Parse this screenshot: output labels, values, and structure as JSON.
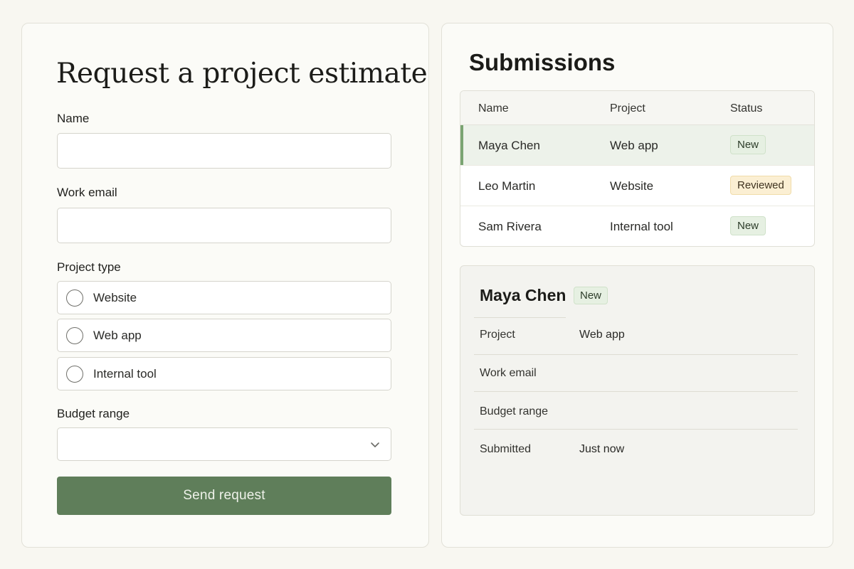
{
  "form": {
    "title": "Request a project estimate",
    "name_label": "Name",
    "name_value": "",
    "email_label": "Work email",
    "email_value": "",
    "project_type_label": "Project type",
    "project_type_options": [
      {
        "label": "Website",
        "selected": false
      },
      {
        "label": "Web app",
        "selected": false
      },
      {
        "label": "Internal tool",
        "selected": false
      }
    ],
    "budget_label": "Budget range",
    "budget_value": "",
    "chevron_icon": "chevron-down-icon",
    "submit_label": "Send request"
  },
  "submissions": {
    "title": "Submissions",
    "columns": [
      "Name",
      "Project",
      "Status"
    ],
    "rows": [
      {
        "name": "Maya Chen",
        "project": "Web app",
        "status": "New",
        "selected": true
      },
      {
        "name": "Leo Martin",
        "project": "Website",
        "status": "Reviewed",
        "selected": false
      },
      {
        "name": "Sam Rivera",
        "project": "Internal tool",
        "status": "New",
        "selected": false
      }
    ],
    "detail": {
      "name": "Maya Chen",
      "status": "New",
      "fields": [
        {
          "key": "Project",
          "value": "Web app"
        },
        {
          "key": "Work email",
          "value": ""
        },
        {
          "key": "Budget range",
          "value": ""
        },
        {
          "key": "Submitted",
          "value": "Just now"
        }
      ]
    }
  },
  "colors": {
    "accent": "#5f7e5a",
    "selected_row": "#edf2ea",
    "selected_row_accent": "#7aa472",
    "status_new_bg": "#e6f0e2",
    "status_reviewed_bg": "#fbefd3",
    "page_background": "#f8f7f1"
  }
}
